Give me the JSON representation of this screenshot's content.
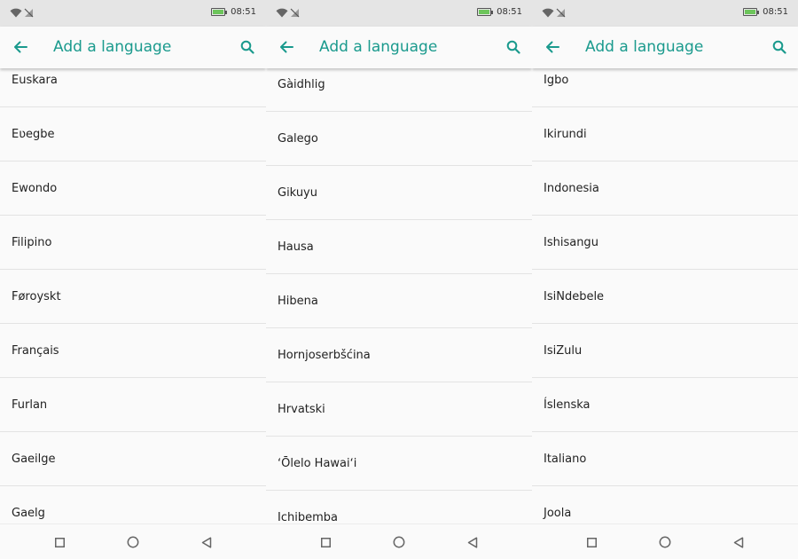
{
  "status": {
    "time": "08:51"
  },
  "app_bar": {
    "title": "Add a language"
  },
  "icons": {
    "back": "arrow-left-icon",
    "search": "search-icon"
  },
  "colors": {
    "accent": "#1a9a8d",
    "battery": "#6dc55b"
  },
  "screens": [
    {
      "languages": [
        "Euskara",
        "Eʋegbe",
        "Ewondo",
        "Filipino",
        "Føroyskt",
        "Français",
        "Furlan",
        "Gaeilge",
        "Gaelg"
      ]
    },
    {
      "languages": [
        "Gàidhlig",
        "Galego",
        "Gikuyu",
        "Hausa",
        "Hibena",
        "Hornjoserbšćina",
        "Hrvatski",
        "ʻŌlelo Hawaiʻi",
        "Ichibemba"
      ]
    },
    {
      "languages": [
        "Igbo",
        "Ikirundi",
        "Indonesia",
        "Ishisangu",
        "IsiNdebele",
        "IsiZulu",
        "Íslenska",
        "Italiano",
        "Joola"
      ]
    }
  ]
}
